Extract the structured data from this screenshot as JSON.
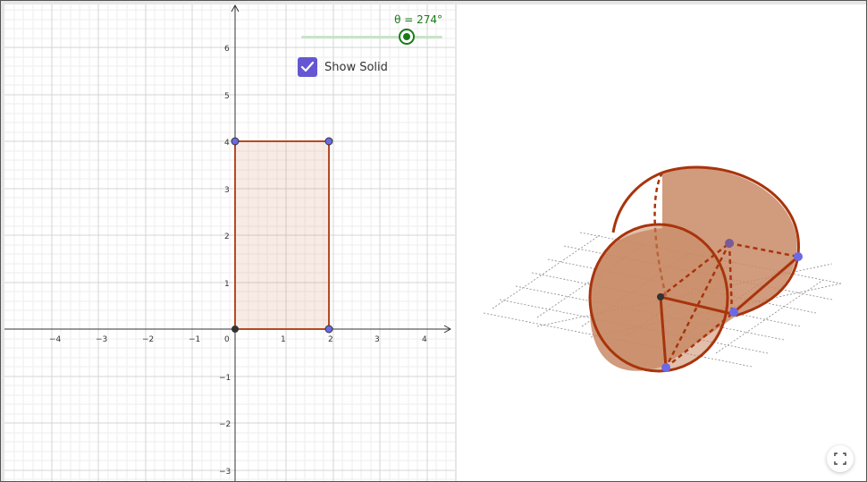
{
  "slider": {
    "label": "θ = 274°",
    "value": 274,
    "min": 0,
    "max": 360
  },
  "checkbox": {
    "label": "Show Solid",
    "checked": true
  },
  "axes2d": {
    "x_ticks": [
      "−4",
      "−3",
      "−2",
      "−1",
      "0",
      "1",
      "2",
      "3",
      "4"
    ],
    "y_ticks": [
      "6",
      "5",
      "4",
      "3",
      "2",
      "1",
      "−1",
      "−2",
      "−3"
    ]
  },
  "rectangle": {
    "vertices": [
      [
        0,
        0
      ],
      [
        2,
        0
      ],
      [
        2,
        4
      ],
      [
        0,
        4
      ]
    ]
  },
  "colors": {
    "accent": "#6557d2",
    "slider": "#1a7a1a",
    "solid_fill": "#c98a66",
    "solid_edge": "#a8340c",
    "point": "#6a6ae6"
  },
  "icons": {
    "fullscreen": "fullscreen-icon",
    "check": "check-icon"
  }
}
